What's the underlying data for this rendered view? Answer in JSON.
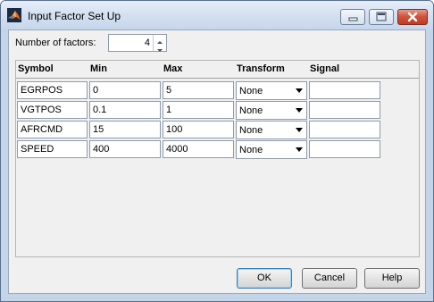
{
  "window": {
    "title": "Input Factor Set Up"
  },
  "factors": {
    "label": "Number of factors:",
    "value": "4"
  },
  "table": {
    "headers": [
      "Symbol",
      "Min",
      "Max",
      "Transform",
      "Signal"
    ],
    "rows": [
      {
        "symbol": "EGRPOS",
        "min": "0",
        "max": "5",
        "transform": "None",
        "signal": ""
      },
      {
        "symbol": "VGTPOS",
        "min": "0.1",
        "max": "1",
        "transform": "None",
        "signal": ""
      },
      {
        "symbol": "AFRCMD",
        "min": "15",
        "max": "100",
        "transform": "None",
        "signal": ""
      },
      {
        "symbol": "SPEED",
        "min": "400",
        "max": "4000",
        "transform": "None",
        "signal": ""
      }
    ]
  },
  "buttons": {
    "ok": "OK",
    "cancel": "Cancel",
    "help": "Help"
  },
  "icons": {
    "app": "matlab-logo-icon",
    "minimize": "minimize-icon",
    "maximize": "maximize-icon",
    "close": "close-icon",
    "spin_up": "chevron-up-icon",
    "spin_down": "chevron-down-icon",
    "dropdown": "chevron-down-icon"
  },
  "colors": {
    "titlebar": "#d3e0f0",
    "close_button": "#c8452c",
    "dialog_bg": "#f0f0f0",
    "ok_border": "#3c7fb1"
  }
}
